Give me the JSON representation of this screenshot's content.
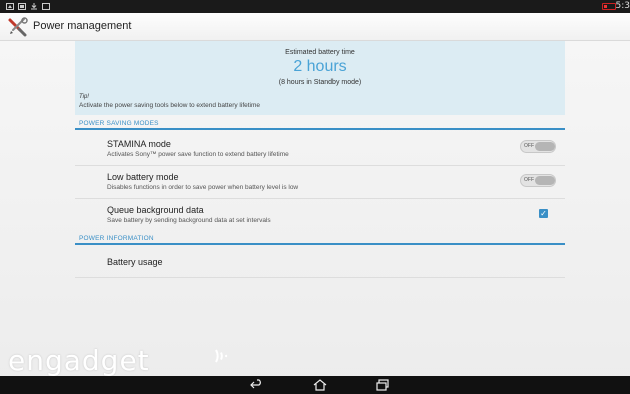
{
  "status_bar": {
    "time": "5:3",
    "battery_color": "#e33333"
  },
  "action_bar": {
    "title": "Power management",
    "icon": "tools-icon"
  },
  "battery": {
    "estimated_label": "Estimated battery time",
    "estimated_value": "2 hours",
    "standby_text": "(8 hours in Standby mode)",
    "tip_title": "Tip!",
    "tip_text": "Activate the power saving tools below to extend battery lifetime"
  },
  "sections": {
    "power_saving_modes": "POWER SAVING MODES",
    "power_information": "POWER INFORMATION"
  },
  "settings": {
    "stamina": {
      "title": "STAMINA mode",
      "subtitle": "Activates Sony™ power save function to extend battery lifetime",
      "state": "OFF"
    },
    "low_battery": {
      "title": "Low battery mode",
      "subtitle": "Disables functions in order to save power when battery level is low",
      "state": "OFF"
    },
    "queue_background": {
      "title": "Queue background data",
      "subtitle": "Save battery by sending background data at set intervals",
      "checked": true
    },
    "battery_usage": {
      "title": "Battery usage"
    }
  },
  "watermark": "engadget",
  "nav": {
    "back": "back-icon",
    "home": "home-icon",
    "recents": "recents-icon"
  },
  "colors": {
    "accent": "#3a8fc6",
    "estimate_text": "#4aa3d6",
    "card_background": "#dcecf3"
  }
}
